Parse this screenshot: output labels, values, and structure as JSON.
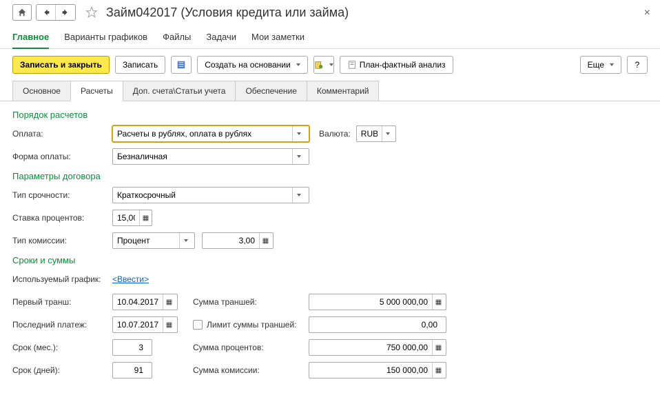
{
  "header": {
    "title": "Займ042017 (Условия кредита или займа)"
  },
  "nav": {
    "tabs": [
      "Главное",
      "Варианты графиков",
      "Файлы",
      "Задачи",
      "Мои заметки"
    ]
  },
  "toolbar": {
    "save_close": "Записать и закрыть",
    "save": "Записать",
    "create_on_basis": "Создать на основании",
    "plan_fact": "План-фактный анализ",
    "more": "Еще",
    "help": "?"
  },
  "subtabs": [
    "Основное",
    "Расчеты",
    "Доп. счета\\Статьи учета",
    "Обеспечение",
    "Комментарий"
  ],
  "sections": {
    "payment_order": "Порядок расчетов",
    "contract_params": "Параметры договора",
    "terms_amounts": "Сроки и суммы"
  },
  "labels": {
    "payment": "Оплата:",
    "currency": "Валюта:",
    "payment_form": "Форма оплаты:",
    "urgency_type": "Тип срочности:",
    "interest_rate": "Ставка процентов:",
    "commission_type": "Тип комиссии:",
    "used_schedule": "Используемый график:",
    "first_tranche": "Первый транш:",
    "tranche_sum": "Сумма траншей:",
    "last_payment": "Последний платеж:",
    "tranche_limit": "Лимит суммы траншей:",
    "term_months": "Срок (мес.):",
    "interest_sum": "Сумма процентов:",
    "term_days": "Срок (дней):",
    "commission_sum": "Сумма комиссии:"
  },
  "values": {
    "payment": "Расчеты в рублях, оплата в рублях",
    "currency": "RUB",
    "payment_form": "Безналичная",
    "urgency_type": "Краткосрочный",
    "interest_rate": "15,00",
    "commission_type": "Процент",
    "commission_value": "3,00",
    "used_schedule_link": "<Ввести>",
    "first_tranche": "10.04.2017",
    "tranche_sum": "5 000 000,00",
    "last_payment": "10.07.2017",
    "tranche_limit": "0,00",
    "term_months": "3",
    "interest_sum": "750 000,00",
    "term_days": "91",
    "commission_sum": "150 000,00"
  }
}
